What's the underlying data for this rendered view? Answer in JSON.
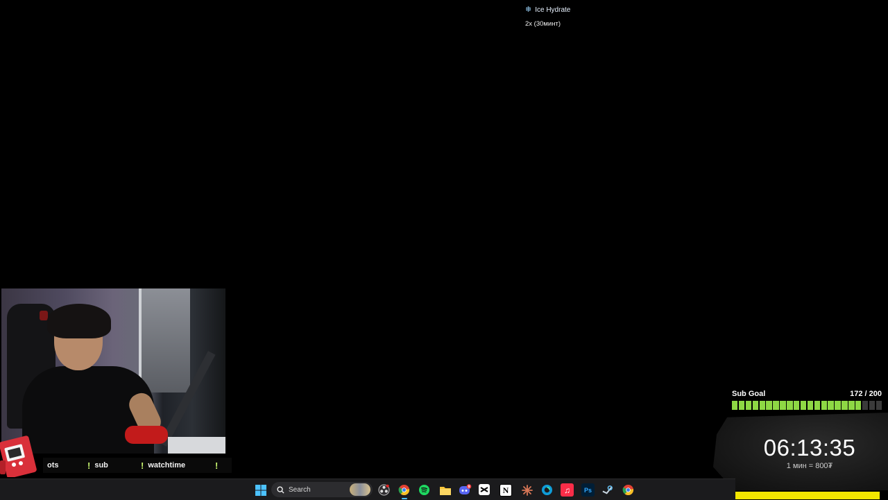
{
  "alert": {
    "title": "Ice Hydrate",
    "icon": "snowflake-icon",
    "subtitle": "2x (30минт)"
  },
  "commands": [
    {
      "bang": "!",
      "label": "ots"
    },
    {
      "bang": "!",
      "label": "sub"
    },
    {
      "bang": "!",
      "label": "watchtime"
    },
    {
      "bang": "!",
      "label": ""
    }
  ],
  "sub_goal": {
    "label": "Sub Goal",
    "count": "172 / 200",
    "current": 172,
    "target": 200,
    "bar_color": "#8ed844"
  },
  "timer": {
    "value": "06:13:35",
    "rate": "1 мин = 800₮"
  },
  "taskbar": {
    "search_placeholder": "Search",
    "apps": [
      "windows-start-icon",
      "search-icon",
      "obs-icon",
      "chrome-icon",
      "spotify-icon",
      "file-explorer-icon",
      "discord-icon",
      "capcut-icon",
      "notion-icon",
      "claude-icon",
      "copilot-icon",
      "apple-music-icon",
      "photoshop-icon",
      "steam-icon",
      "chrome-icon"
    ],
    "discord_badge": "9",
    "photoshop_label": "Ps"
  },
  "colors": {
    "accent_green": "#c6f36e",
    "timer_bar_yellow": "#f3e600",
    "taskbar_bg": "#1b1b1d"
  }
}
